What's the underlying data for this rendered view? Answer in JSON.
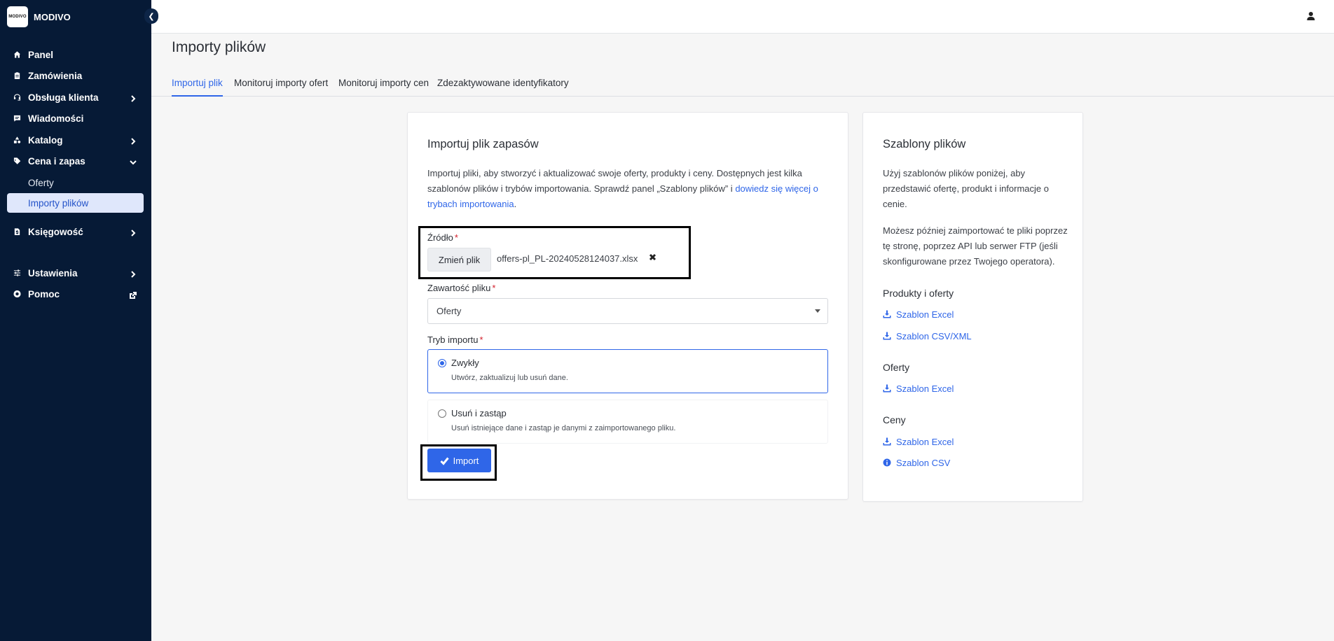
{
  "brand": {
    "logo_text": "MODIVO",
    "name": "MODIVO"
  },
  "nav": {
    "items": [
      {
        "label": "Panel"
      },
      {
        "label": "Zamówienia"
      },
      {
        "label": "Obsługa klienta"
      },
      {
        "label": "Wiadomości"
      },
      {
        "label": "Katalog"
      },
      {
        "label": "Cena i zapas"
      },
      {
        "label": "Księgowość"
      },
      {
        "label": "Ustawienia"
      },
      {
        "label": "Pomoc"
      }
    ],
    "sub_items": [
      {
        "label": "Oferty"
      },
      {
        "label": "Importy plików"
      }
    ]
  },
  "page": {
    "title": "Importy plików"
  },
  "tabs": [
    {
      "label": "Importuj plik"
    },
    {
      "label": "Monitoruj importy ofert"
    },
    {
      "label": "Monitoruj importy cen"
    },
    {
      "label": "Zdezaktywowane identyfikatory"
    }
  ],
  "import_card": {
    "title": "Importuj plik zapasów",
    "desc_line1": "Importuj pliki, aby stworzyć i aktualizować swoje oferty, produkty i ceny. Dostępnych jest kilka",
    "desc_line2": "szablonów plików i trybów importowania. Sprawdź panel „Szablony plików” i ",
    "desc_link_part1": "dowiedz się więcej o",
    "desc_link_part2": "trybach importowania",
    "desc_end": ".",
    "source_label": "Źródło",
    "required_mark": "*",
    "change_file_label": "Zmień plik",
    "file_name": "offers-pl_PL-20240528124037.xlsx",
    "content_label": "Zawartość pliku",
    "content_value": "Oferty",
    "mode_label": "Tryb importu",
    "modes": [
      {
        "title": "Zwykły",
        "desc": "Utwórz, zaktualizuj lub usuń dane.",
        "selected": true
      },
      {
        "title": "Usuń i zastąp",
        "desc": "Usuń istniejące dane i zastąp je danymi z zaimportowanego pliku.",
        "selected": false
      }
    ],
    "import_label": "Import"
  },
  "templates_card": {
    "title": "Szablony plików",
    "desc1_line1": "Użyj szablonów plików poniżej, aby",
    "desc1_line2": "przedstawić ofertę, produkt i informacje o",
    "desc1_line3": "cenie.",
    "desc2_line1": "Możesz później zaimportować te pliki poprzez",
    "desc2_line2": "tę stronę, poprzez API lub serwer FTP (jeśli",
    "desc2_line3": "skonfigurowane przez Twojego operatora).",
    "groups": [
      {
        "title": "Produkty i oferty",
        "links": [
          {
            "label": "Szablon Excel",
            "icon": "download-icon"
          },
          {
            "label": "Szablon CSV/XML",
            "icon": "download-icon"
          }
        ]
      },
      {
        "title": "Oferty",
        "links": [
          {
            "label": "Szablon Excel",
            "icon": "download-icon"
          }
        ]
      },
      {
        "title": "Ceny",
        "links": [
          {
            "label": "Szablon Excel",
            "icon": "download-icon"
          },
          {
            "label": "Szablon CSV",
            "icon": "info-icon"
          }
        ]
      }
    ]
  },
  "colors": {
    "sidebar_bg": "#061a36",
    "accent": "#2f66e8",
    "active_sub_bg": "#dfe7fb",
    "required": "#d2202c"
  }
}
